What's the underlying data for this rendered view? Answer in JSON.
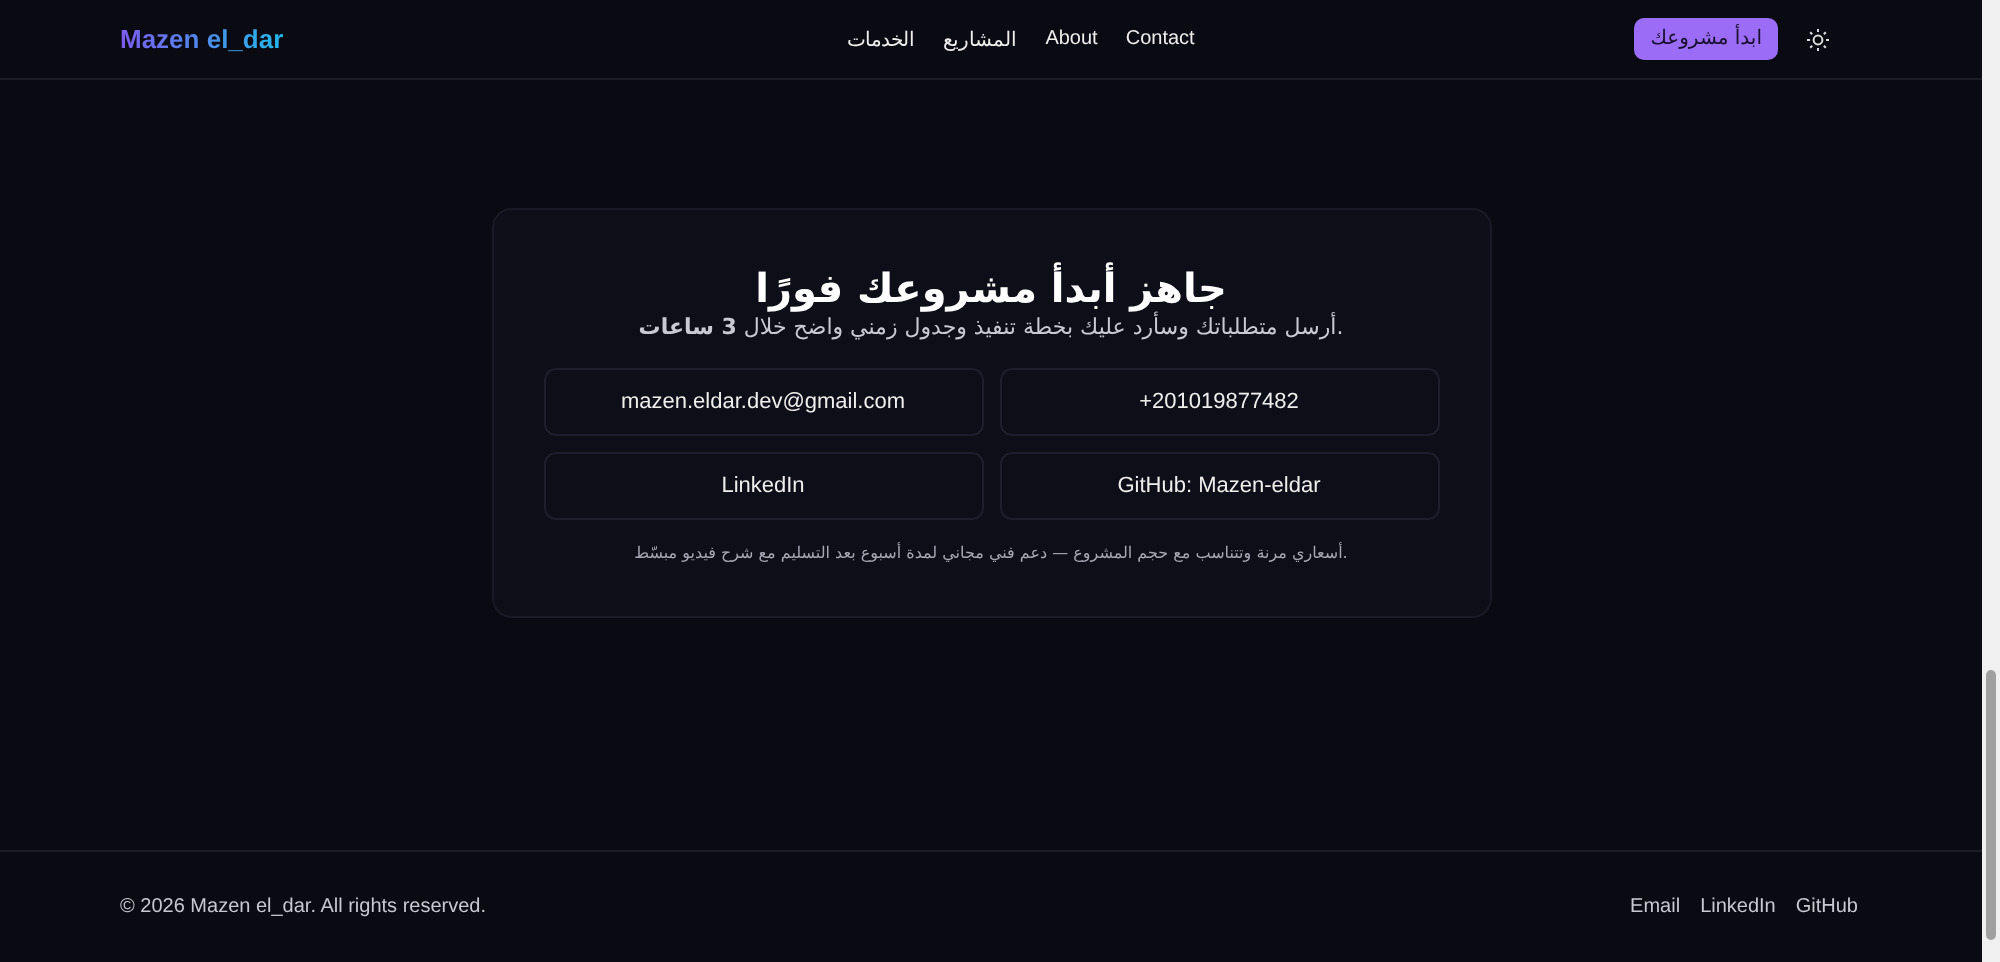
{
  "header": {
    "logo": "Mazen el_dar",
    "nav": [
      "Contact",
      "About",
      "المشاريع",
      "الخدمات"
    ],
    "cta": "ابدأ مشروعك"
  },
  "card": {
    "title": "جاهز أبدأ مشروعك فورًا",
    "subtitle": "أرسل متطلباتك وسأرد عليك بخطة تنفيذ وجدول زمني واضح خلال **3 ساعات**.",
    "contacts": [
      "+201019877482",
      "mazen.eldar.dev@gmail.com",
      "GitHub: Mazen-eldar",
      "LinkedIn"
    ],
    "note": "أسعاري مرنة وتتناسب مع حجم المشروع — دعم فني مجاني لمدة أسبوع بعد التسليم مع شرح فيديو مبسّط."
  },
  "footer": {
    "copyright": "© 2026 Mazen el_dar. All rights reserved.",
    "links": [
      "GitHub",
      "LinkedIn",
      "Email"
    ]
  }
}
